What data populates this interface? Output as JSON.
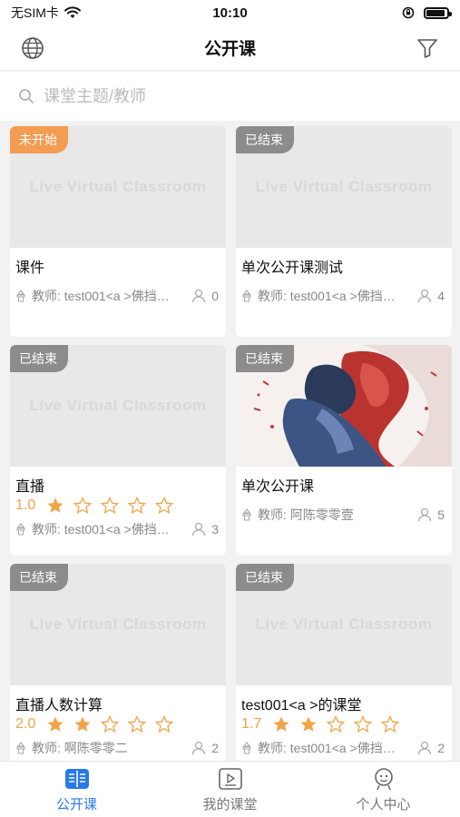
{
  "status_bar": {
    "carrier": "无SIM卡",
    "time": "10:10"
  },
  "nav": {
    "title": "公开课",
    "left_icon": "globe-icon",
    "right_icon": "filter-icon"
  },
  "search": {
    "placeholder": "课堂主题/教师",
    "value": ""
  },
  "watermark": "Live Virtual Classroom",
  "cards": [
    {
      "badge": "未开始",
      "badge_type": "pending",
      "title": "课件",
      "rating": null,
      "teacher": "教师: test001<a >佛挡…",
      "count": "0",
      "has_image": false
    },
    {
      "badge": "已结束",
      "badge_type": "ended",
      "title": "单次公开课测试",
      "rating": null,
      "teacher": "教师: test001<a >佛挡…",
      "count": "4",
      "has_image": false
    },
    {
      "badge": "已结束",
      "badge_type": "ended",
      "title": "直播",
      "rating": "1.0",
      "stars": 1,
      "teacher": "教师: test001<a >佛挡…",
      "count": "3",
      "has_image": false
    },
    {
      "badge": "已结束",
      "badge_type": "ended",
      "title": "单次公开课",
      "rating": null,
      "teacher": "教师: 阿陈零零壹",
      "count": "5",
      "has_image": true
    },
    {
      "badge": "已结束",
      "badge_type": "ended",
      "title": "直播人数计算",
      "rating": "2.0",
      "stars": 2,
      "teacher": "教师: 啊陈零零二",
      "count": "2",
      "has_image": false
    },
    {
      "badge": "已结束",
      "badge_type": "ended",
      "title": "test001<a >的课堂",
      "rating": "1.7",
      "stars": 2,
      "teacher": "教师: test001<a >佛挡…",
      "count": "2",
      "has_image": false
    }
  ],
  "tabs": [
    {
      "label": "公开课",
      "icon": "book-icon",
      "active": true
    },
    {
      "label": "我的课堂",
      "icon": "video-icon",
      "active": false
    },
    {
      "label": "个人中心",
      "icon": "person-icon",
      "active": false
    }
  ],
  "colors": {
    "accent": "#2a79e8",
    "star": "#f0a447",
    "badge_pending": "#f39c52",
    "badge_ended": "#8c8c8c"
  }
}
